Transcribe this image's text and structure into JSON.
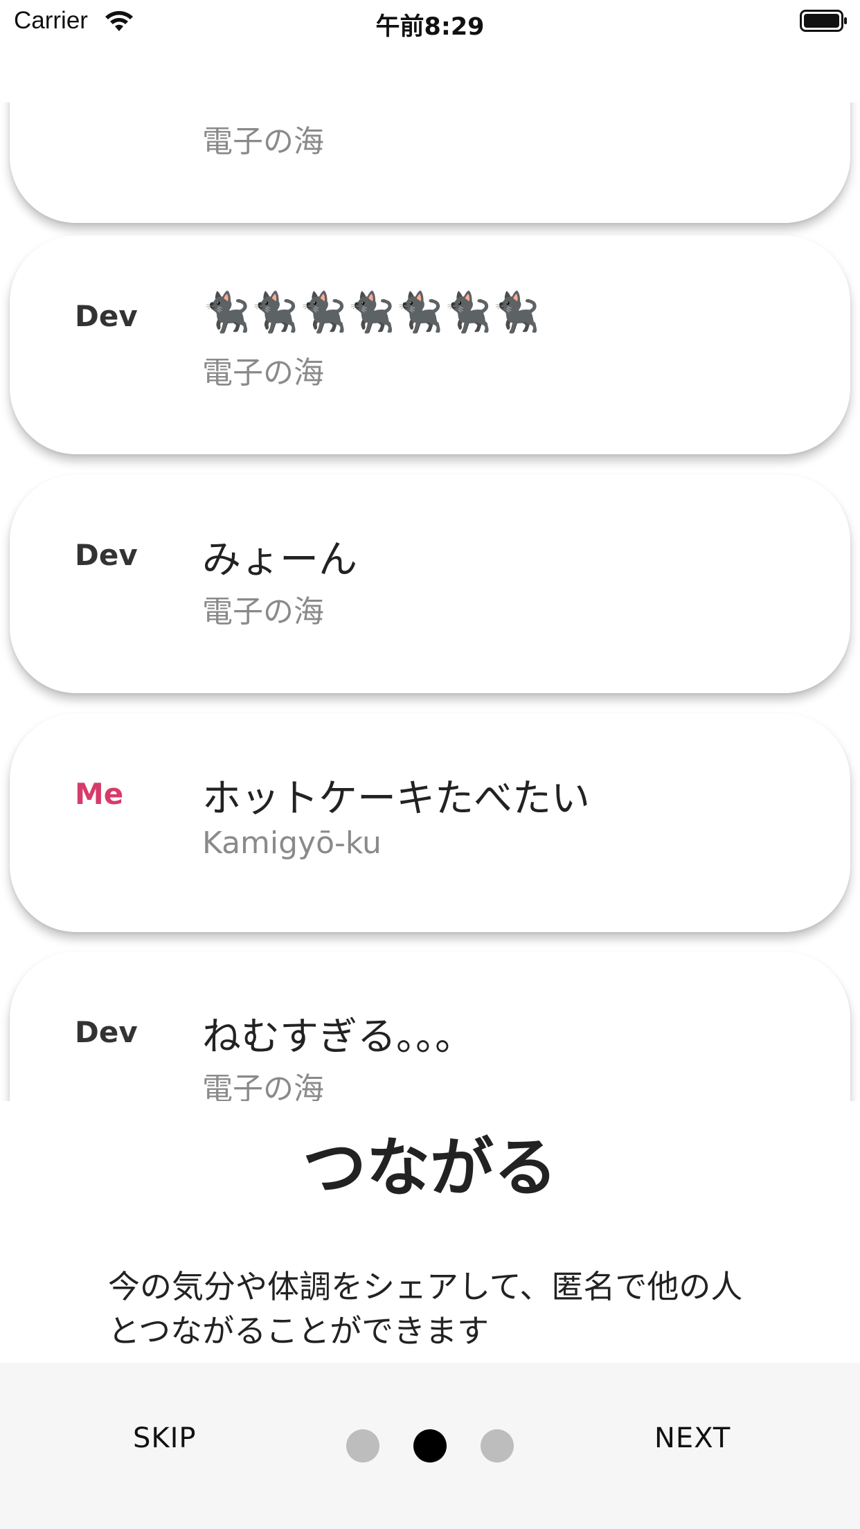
{
  "status_bar": {
    "carrier": "Carrier",
    "time": "午前8:29"
  },
  "feed": [
    {
      "author": "",
      "message": "",
      "location": "電子の海",
      "is_me": false
    },
    {
      "author": "Dev",
      "message": "🐈‍⬛🐈‍⬛🐈‍⬛🐈‍⬛🐈‍⬛🐈‍⬛🐈‍⬛",
      "location": "電子の海",
      "is_me": false
    },
    {
      "author": "Dev",
      "message": "みょーん",
      "location": "電子の海",
      "is_me": false
    },
    {
      "author": "Me",
      "message": "ホットケーキたべたい",
      "location": "Kamigyō-ku",
      "is_me": true
    },
    {
      "author": "Dev",
      "message": "ねむすぎる。。。",
      "location": "電子の海",
      "is_me": false
    }
  ],
  "onboarding": {
    "title": "つながる",
    "description": "今の気分や体調をシェアして、匿名で他の人とつながることができます"
  },
  "bottom_bar": {
    "skip_label": "SKIP",
    "next_label": "NEXT",
    "page_count": 3,
    "current_page_index": 1
  },
  "colors": {
    "me_accent": "#d63b6a",
    "dot_active": "#000000",
    "dot_inactive": "#bdbdbd",
    "bottom_bar_bg": "#f6f6f6"
  },
  "icons": [
    "wifi-icon",
    "battery-icon"
  ]
}
